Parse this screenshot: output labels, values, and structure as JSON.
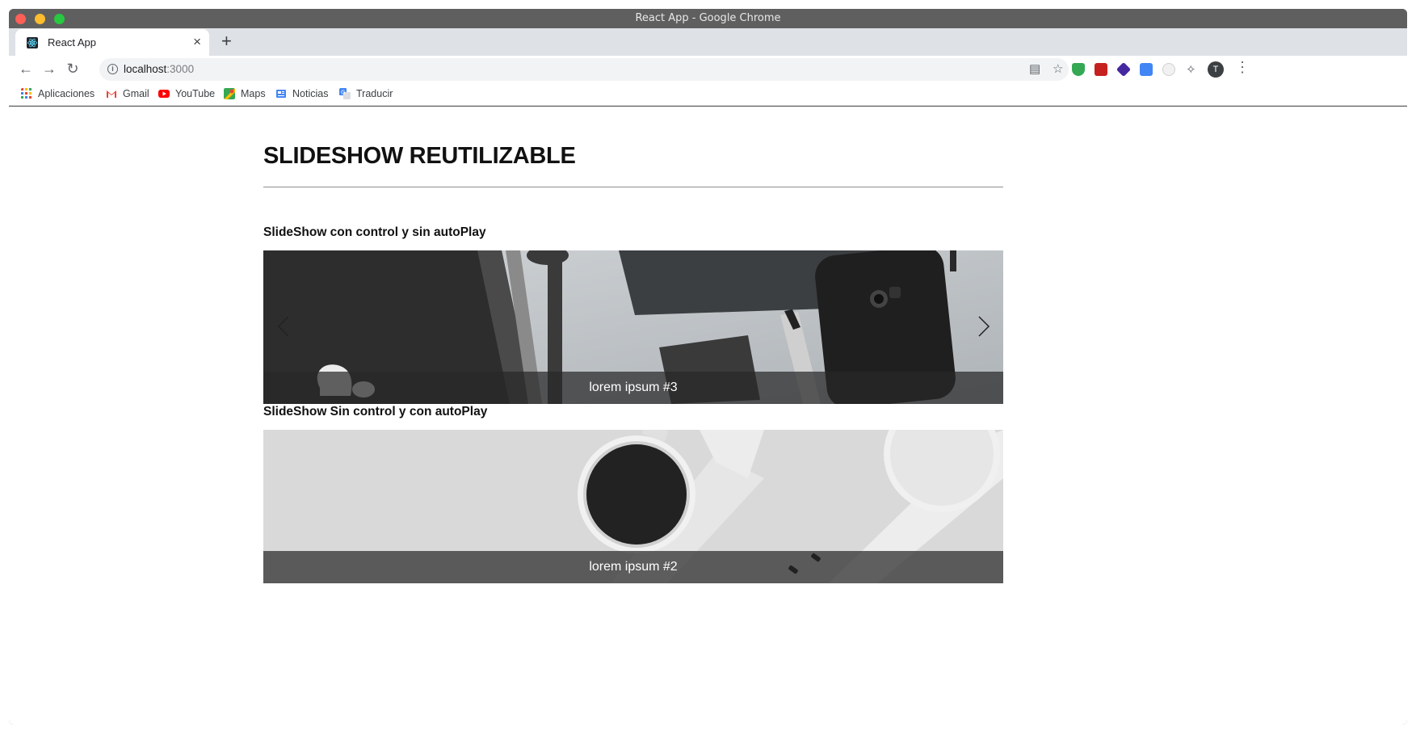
{
  "window": {
    "title": "React App - Google Chrome"
  },
  "tab": {
    "title": "React App",
    "close": "×",
    "new_tab": "+"
  },
  "toolbar": {
    "url_host": "localhost",
    "url_port": ":3000",
    "back_icon": "arrow-left-icon",
    "forward_icon": "arrow-right-icon",
    "reload_icon": "reload-icon",
    "avatar_initial": "T"
  },
  "bookmarks": [
    {
      "label": "Aplicaciones",
      "icon": "apps-grid-icon"
    },
    {
      "label": "Gmail",
      "icon": "gmail-icon"
    },
    {
      "label": "YouTube",
      "icon": "youtube-icon"
    },
    {
      "label": "Maps",
      "icon": "maps-icon"
    },
    {
      "label": "Noticias",
      "icon": "news-icon"
    },
    {
      "label": "Traducir",
      "icon": "translate-icon"
    }
  ],
  "page": {
    "title": "SLIDESHOW REUTILIZABLE",
    "section1": {
      "title": "SlideShow con control y sin autoPlay",
      "caption": "lorem ipsum #3"
    },
    "section2": {
      "title": "SlideShow Sin control y con autoPlay",
      "caption": "lorem ipsum #2"
    }
  },
  "colors": {
    "frame": "#5f5f5f",
    "tabstrip": "#dee1e6",
    "omnibox": "#f1f3f4",
    "caption_bg": "#3a3a3a"
  }
}
